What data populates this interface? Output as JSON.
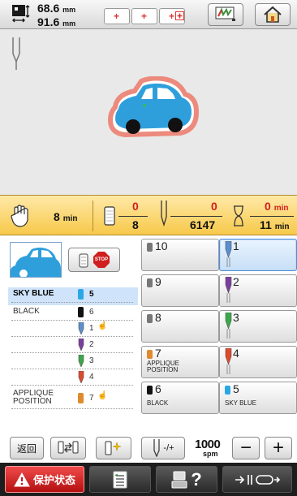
{
  "header": {
    "width_value": "68.6",
    "height_value": "91.6",
    "unit": "mm",
    "frame_buttons": [
      "+",
      "+",
      "+"
    ]
  },
  "stats": {
    "time_value": "8",
    "time_unit": "min",
    "color_done": "0",
    "color_total": "8",
    "stitch_done": "0",
    "stitch_total": "6147",
    "remaining_done": "0",
    "remaining_total": "11",
    "remaining_unit": "min"
  },
  "color_list": [
    {
      "label": "SKY BLUE",
      "number": "5",
      "type": "spool",
      "color": "#2aa8e6",
      "bold": true
    },
    {
      "label": "BLACK",
      "number": "6",
      "type": "spool",
      "color": "#111111",
      "bold": false
    },
    {
      "label": "",
      "number": "1",
      "type": "needle",
      "color": "#5a8fd0",
      "hand": true
    },
    {
      "label": "",
      "number": "2",
      "type": "needle",
      "color": "#7a3ea0",
      "hand": false
    },
    {
      "label": "",
      "number": "3",
      "type": "needle",
      "color": "#3aa84a",
      "hand": false
    },
    {
      "label": "",
      "number": "4",
      "type": "needle",
      "color": "#e0492b",
      "hand": false
    },
    {
      "label": "APPLIQUE POSITION",
      "number": "7",
      "type": "spool",
      "color": "#e08a2e",
      "hand": true
    }
  ],
  "grid": [
    {
      "num": "10",
      "name": "",
      "kind": "spool",
      "color": "#777777"
    },
    {
      "num": "1",
      "name": "",
      "kind": "needle",
      "color": "#5a8fd0",
      "active": true
    },
    {
      "num": "9",
      "name": "",
      "kind": "spool",
      "color": "#777777"
    },
    {
      "num": "2",
      "name": "",
      "kind": "needle",
      "color": "#7a3ea0"
    },
    {
      "num": "8",
      "name": "",
      "kind": "spool",
      "color": "#777777"
    },
    {
      "num": "3",
      "name": "",
      "kind": "needle",
      "color": "#3aa84a"
    },
    {
      "num": "7",
      "name": "APPLIQUE POSITION",
      "kind": "spool",
      "color": "#e08a2e"
    },
    {
      "num": "4",
      "name": "",
      "kind": "needle",
      "color": "#e0492b"
    },
    {
      "num": "6",
      "name": "BLACK",
      "kind": "spool",
      "color": "#111111"
    },
    {
      "num": "5",
      "name": "SKY BLUE",
      "kind": "spool",
      "color": "#2aa8e6"
    }
  ],
  "controls": {
    "back_label": "返回",
    "speed_value": "1000",
    "speed_unit": "spm",
    "needle_adjust_label": "-/+",
    "minus_label": "−",
    "plus_label": "+"
  },
  "tabs": {
    "protect_label": "保护状态"
  },
  "colors": {
    "accent_red": "#d21f1f",
    "stats_bg": "#f7c94a",
    "selected_blue": "#cfe4fa"
  }
}
